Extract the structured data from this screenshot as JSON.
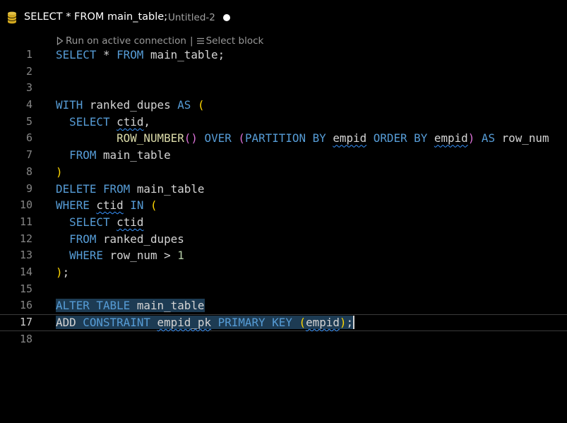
{
  "tab": {
    "title": "SELECT * FROM main_table;",
    "description": "Untitled-2",
    "icon": "database-icon",
    "dirty": true
  },
  "codelens": {
    "run_label": "Run on active connection",
    "separator": "|",
    "select_label": "Select block"
  },
  "editor": {
    "current_line": 17,
    "lines": [
      {
        "n": "1",
        "text": "SELECT * FROM main_table;"
      },
      {
        "n": "2",
        "text": ""
      },
      {
        "n": "3",
        "text": ""
      },
      {
        "n": "4",
        "text": "WITH ranked_dupes AS ("
      },
      {
        "n": "5",
        "text": "  SELECT ctid,"
      },
      {
        "n": "6",
        "text": "         ROW_NUMBER() OVER (PARTITION BY empid ORDER BY empid) AS row_num"
      },
      {
        "n": "7",
        "text": "  FROM main_table"
      },
      {
        "n": "8",
        "text": ")"
      },
      {
        "n": "9",
        "text": "DELETE FROM main_table"
      },
      {
        "n": "10",
        "text": "WHERE ctid IN ("
      },
      {
        "n": "11",
        "text": "  SELECT ctid"
      },
      {
        "n": "12",
        "text": "  FROM ranked_dupes"
      },
      {
        "n": "13",
        "text": "  WHERE row_num > 1"
      },
      {
        "n": "14",
        "text": ");"
      },
      {
        "n": "15",
        "text": ""
      },
      {
        "n": "16",
        "text": "ALTER TABLE main_table"
      },
      {
        "n": "17",
        "text": "ADD CONSTRAINT empid_pk PRIMARY KEY (empid);"
      },
      {
        "n": "18",
        "text": ""
      }
    ]
  },
  "colors": {
    "background": "#000000",
    "keyword": "#569cd6",
    "function": "#dcdcaa",
    "number": "#b5cea8",
    "bracket_1": "#ffd700",
    "bracket_2": "#da70d6",
    "squiggle": "#3794ff",
    "selection": "#1d3b53"
  }
}
